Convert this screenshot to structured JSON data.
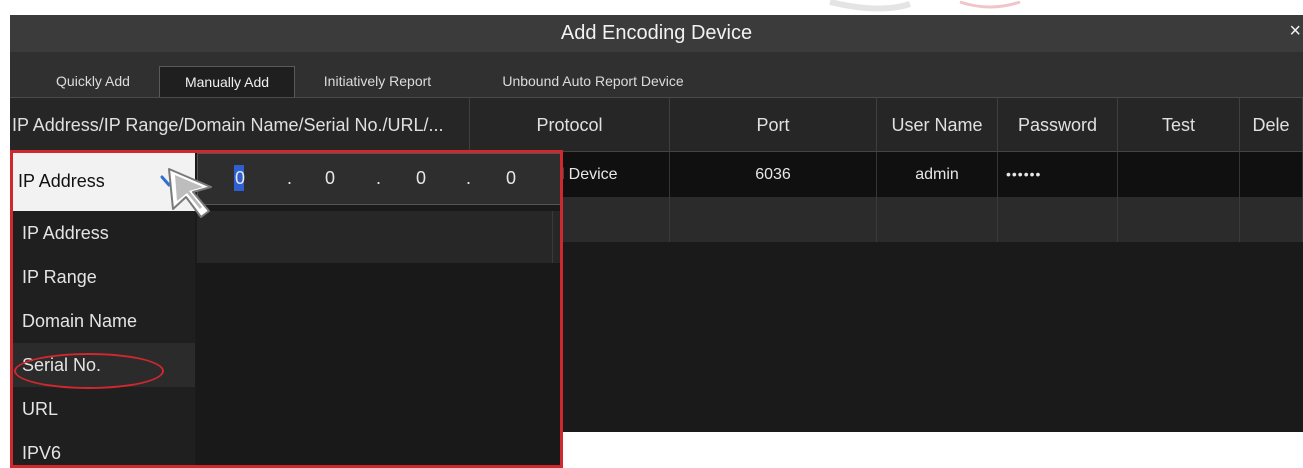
{
  "dialog": {
    "title": "Add  Encoding Device",
    "close_glyph": "×"
  },
  "tabs": [
    {
      "label": "Quickly Add",
      "active": false
    },
    {
      "label": "Manually Add",
      "active": true
    },
    {
      "label": "Initiatively Report",
      "active": false
    },
    {
      "label": "Unbound Auto Report Device",
      "active": false
    }
  ],
  "table": {
    "columns": [
      "IP Address/IP Range/Domain Name/Serial No./URL/...",
      "Protocol",
      "Port",
      "User Name",
      "Password",
      "Test",
      "Dele"
    ],
    "rows": [
      {
        "protocol": "rd Device",
        "port": "6036",
        "user_name": "admin",
        "password": "••••••",
        "test": "",
        "delete": ""
      }
    ]
  },
  "address_editor": {
    "selected_type": "IP Address",
    "chevron_glyph": "✓",
    "ip_octets": [
      "0",
      "0",
      "0",
      "0"
    ],
    "dot": "."
  },
  "type_dropdown": {
    "options": [
      "IP Address",
      "IP Range",
      "Domain Name",
      "Serial No.",
      "URL",
      "IPV6"
    ],
    "highlighted": "Serial No."
  },
  "colors": {
    "annotation_red": "#d0282f",
    "caret_blue": "#2f5fd0"
  },
  "icons": {
    "cursor": "mouse-pointer-icon",
    "close": "close-icon",
    "chevron": "chevron-down-icon"
  }
}
